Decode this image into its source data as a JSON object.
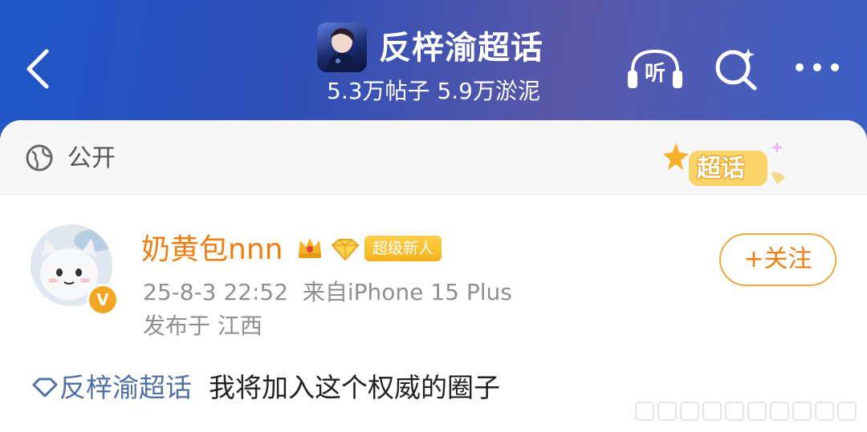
{
  "header": {
    "forum_title": "反梓渝超话",
    "stats": "5.3万帖子 5.9万淤泥"
  },
  "icons": {
    "back": "chevron-left-icon",
    "listen_label": "听",
    "search": "search-sparkle-icon",
    "more": "more-dots-icon"
  },
  "visibility": {
    "label": "公开",
    "badge": "超话"
  },
  "post": {
    "username": "奶黄包nnn",
    "level_badge": "超级新人",
    "timestamp": "25-8-3 22:52",
    "source": "来自iPhone 15 Plus",
    "location": "发布于 江西",
    "follow_label": "+关注",
    "vbadge": "V",
    "topic_tag": "反梓渝超话",
    "content": "我将加入这个权威的圈子"
  },
  "colors": {
    "header_gradient_start": "#1f57c8",
    "header_gradient_mid": "#5a58a8",
    "username": "#f27c12",
    "follow_border": "#f3a743",
    "tag": "#4f6fa6",
    "meta": "#8f8f8f"
  }
}
